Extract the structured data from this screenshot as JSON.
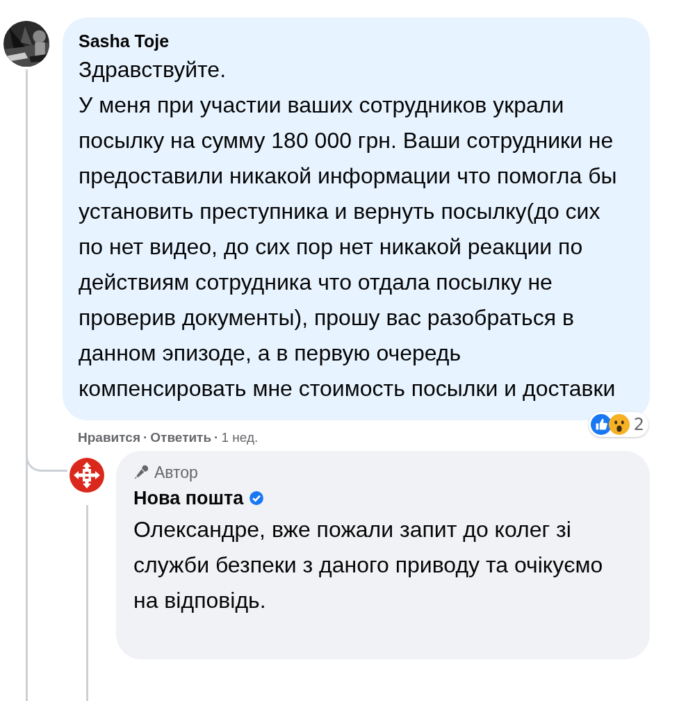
{
  "comments": [
    {
      "author": "Sasha Toje",
      "paragraphs": [
        "Здравствуйте.",
        "У меня при участии ваших сотрудников украли посылку на сумму 180 000 грн. Ваши сотрудники не предоставили никакой информации что помогла бы установить преступника и вернуть посылку(до сих по нет видео, до сих пор нет никакой реакции по действиям сотрудника что отдала посылку не проверив документы), прошу вас разобраться в данном эпизоде, а в первую очередь компенсировать мне стоимость посылки и доставки"
      ],
      "reaction_count": "2",
      "actions": [
        "Нравится",
        "Ответить"
      ],
      "separator": "·",
      "time": "1 нед."
    },
    {
      "author": "Нова пошта",
      "badge": "Автор",
      "verified": true,
      "avatar": {
        "kind": "logo"
      },
      "paragraphs": [
        "Олександре, вже пожали запит до колег зі служби безпеки з даного приводу та очікуємо на відповідь."
      ]
    }
  ]
}
